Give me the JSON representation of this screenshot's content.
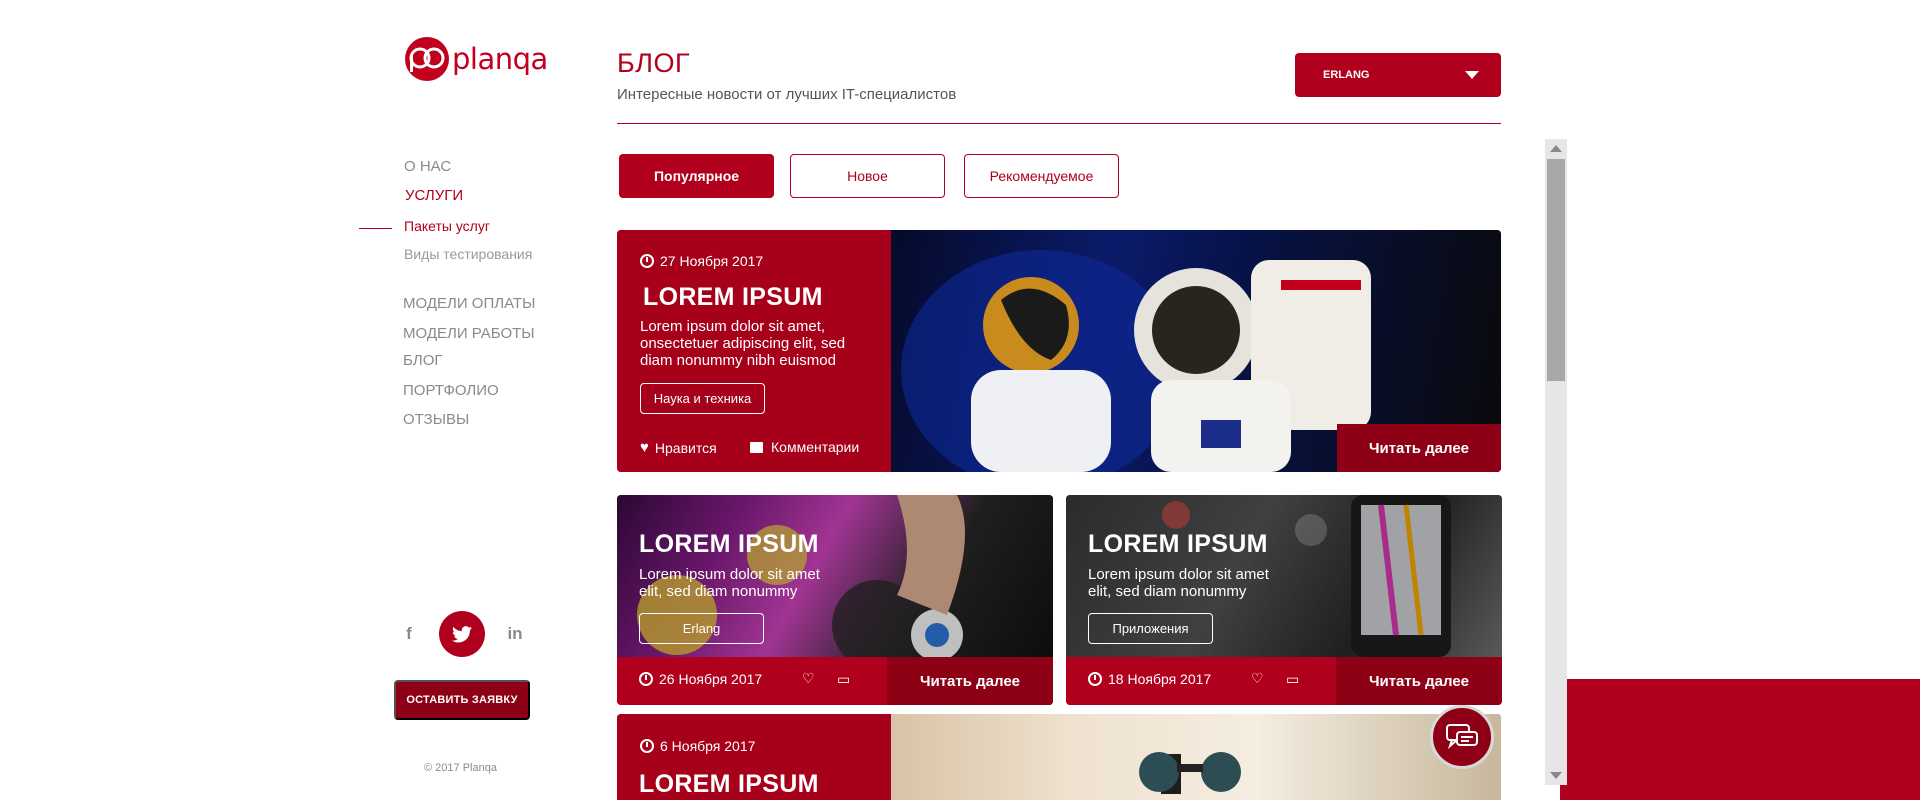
{
  "brand": {
    "name": "planqa",
    "accent": "#b0001e"
  },
  "sidebar": {
    "nav": [
      {
        "label": "О НАС"
      },
      {
        "label": "УСЛУГИ"
      },
      {
        "label": "Пакеты услуг"
      },
      {
        "label": "Виды тестирования"
      },
      {
        "label": "МОДЕЛИ ОПЛАТЫ"
      },
      {
        "label": "МОДЕЛИ РАБОТЫ"
      },
      {
        "label": "БЛОГ"
      },
      {
        "label": "ПОРТФОЛИО"
      },
      {
        "label": "ОТЗЫВЫ"
      }
    ],
    "social": {
      "facebook": "f",
      "linkedin": "in"
    },
    "cta_label": "ОСТАВИТЬ ЗАЯВКУ",
    "copyright": "© 2017 Planqa"
  },
  "header": {
    "title": "БЛОГ",
    "subtitle": "Интересные новости от лучших IT-специалистов",
    "category_select": "ERLANG"
  },
  "tabs": [
    {
      "label": "Популярное"
    },
    {
      "label": "Новое"
    },
    {
      "label": "Рекомендуемое"
    }
  ],
  "featured": {
    "date": "27 Ноября 2017",
    "title": "LOREM IPSUM",
    "text": "Lorem ipsum dolor sit amet, onsectetuer adipiscing elit, sed diam nonummy nibh euismod",
    "tag": "Наука и техника",
    "like_label": "Нравится",
    "comments_label": "Комментарии",
    "read_more": "Читать далее"
  },
  "cards": [
    {
      "title": "LOREM IPSUM",
      "text": "Lorem ipsum dolor sit amet elit, sed diam nonummy",
      "tag": "Erlang",
      "date": "26 Ноября 2017",
      "read_more": "Читать далее"
    },
    {
      "title": "LOREM IPSUM",
      "text": "Lorem ipsum dolor sit amet elit, sed diam nonummy",
      "tag": "Приложения",
      "date": "18 Ноября 2017",
      "read_more": "Читать далее"
    }
  ],
  "bottom_card": {
    "date": "6 Ноября 2017",
    "title": "LOREM IPSUM"
  }
}
